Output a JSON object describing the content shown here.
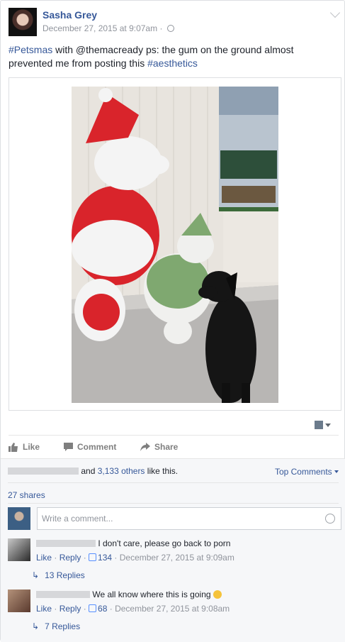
{
  "post": {
    "author": "Sasha Grey",
    "timestamp": "December 27, 2015 at 9:07am",
    "text_parts": [
      "#Petsmas",
      " with @themacready ps: the gum on the ground almost prevented me from posting this ",
      "#aesthetics"
    ]
  },
  "actions": {
    "like": "Like",
    "comment": "Comment",
    "share": "Share"
  },
  "engagement": {
    "likes_suffix": "and",
    "others_link": "3,133 others",
    "likes_end": "like this.",
    "top_comments": "Top Comments",
    "shares": "27 shares"
  },
  "compose": {
    "placeholder": "Write a comment..."
  },
  "comments": [
    {
      "text": "I don't care, please go back to porn",
      "like": "Like",
      "reply": "Reply",
      "likes": "134",
      "time": "December 27, 2015 at 9:09am",
      "replies": "13 Replies"
    },
    {
      "text": "We all know where this is going",
      "like": "Like",
      "reply": "Reply",
      "likes": "68",
      "time": "December 27, 2015 at 9:08am",
      "replies": "7 Replies"
    }
  ],
  "colors": {
    "link": "#365899",
    "muted": "#90949c",
    "brand": "#4267b2"
  },
  "icons": [
    "globe-icon",
    "chevron-down-icon",
    "like-icon",
    "comment-icon",
    "share-icon",
    "emoji-icon",
    "reply-arrow-icon"
  ]
}
